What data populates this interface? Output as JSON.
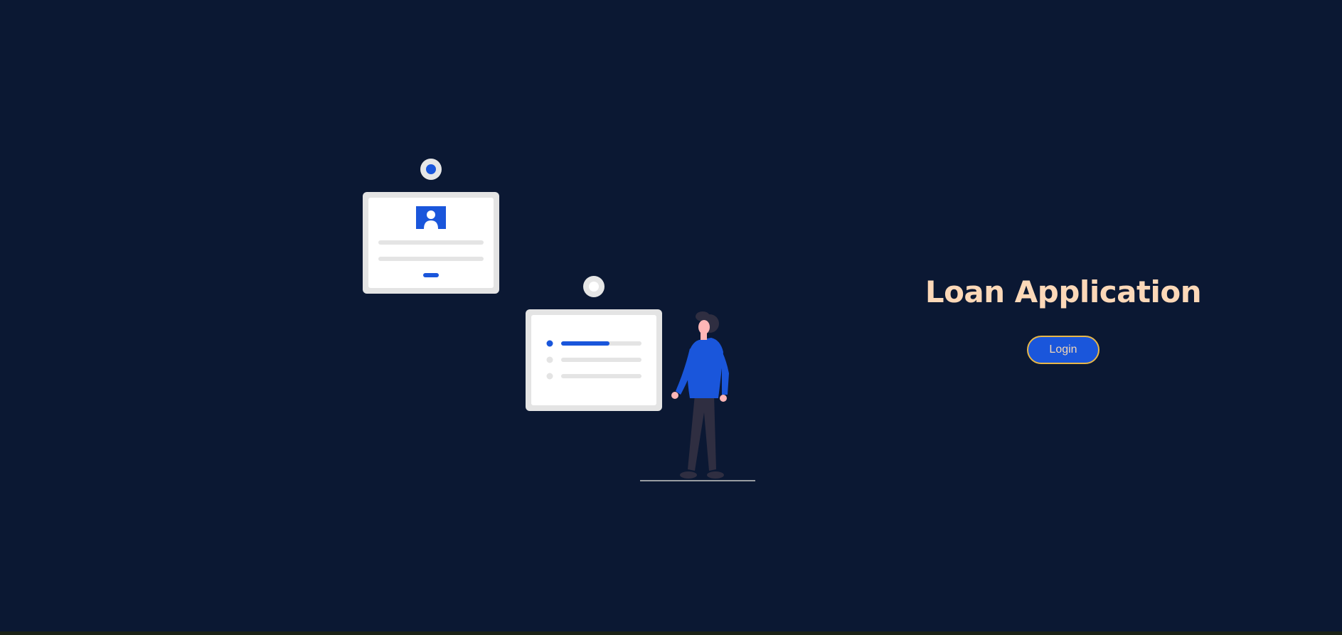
{
  "hero": {
    "title": "Loan Application",
    "login_label": "Login"
  },
  "colors": {
    "background": "#0b1833",
    "title": "#fcd8b8",
    "button_fill": "#1a56db",
    "button_border": "#e8b748",
    "accent": "#1a56db"
  },
  "illustration": {
    "icons": [
      "profile-card-icon",
      "progress-list-card-icon",
      "person-figure"
    ]
  }
}
